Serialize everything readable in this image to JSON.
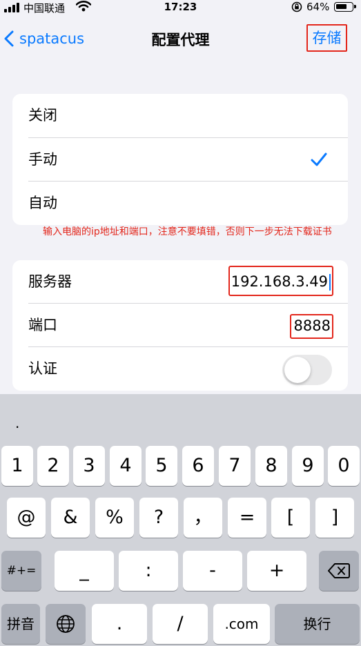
{
  "status_bar": {
    "carrier": "中国联通",
    "time": "17:23",
    "battery": "64%"
  },
  "nav": {
    "back_label": "spatacus",
    "title": "配置代理",
    "save_label": "存储"
  },
  "proxy_mode": {
    "options": [
      "关闭",
      "手动",
      "自动"
    ],
    "selected": "手动"
  },
  "annotation": "输入电脑的ip地址和端口，注意不要填错，否则下一步无法下载证书",
  "manual": {
    "server_label": "服务器",
    "server_value": "192.168.3.49",
    "port_label": "端口",
    "port_value": "8888",
    "auth_label": "认证",
    "auth_enabled": false
  },
  "keyboard": {
    "suggestion": ".",
    "row1": [
      "1",
      "2",
      "3",
      "4",
      "5",
      "6",
      "7",
      "8",
      "9",
      "0"
    ],
    "row2": [
      "@",
      "&",
      "%",
      "?",
      "，",
      "=",
      "[",
      "]"
    ],
    "row3": [
      "#+=",
      "_",
      ":",
      "-",
      "+"
    ],
    "row4": [
      "拼音",
      ".",
      "/",
      ".com",
      "换行"
    ]
  },
  "colors": {
    "accent": "#0a7aff",
    "annotation_red": "#e3261b"
  },
  "icons": [
    "signal-icon",
    "wifi-icon",
    "orientation-lock-icon",
    "battery-icon",
    "back-chevron-icon",
    "checkmark-icon",
    "globe-icon",
    "backspace-icon"
  ]
}
